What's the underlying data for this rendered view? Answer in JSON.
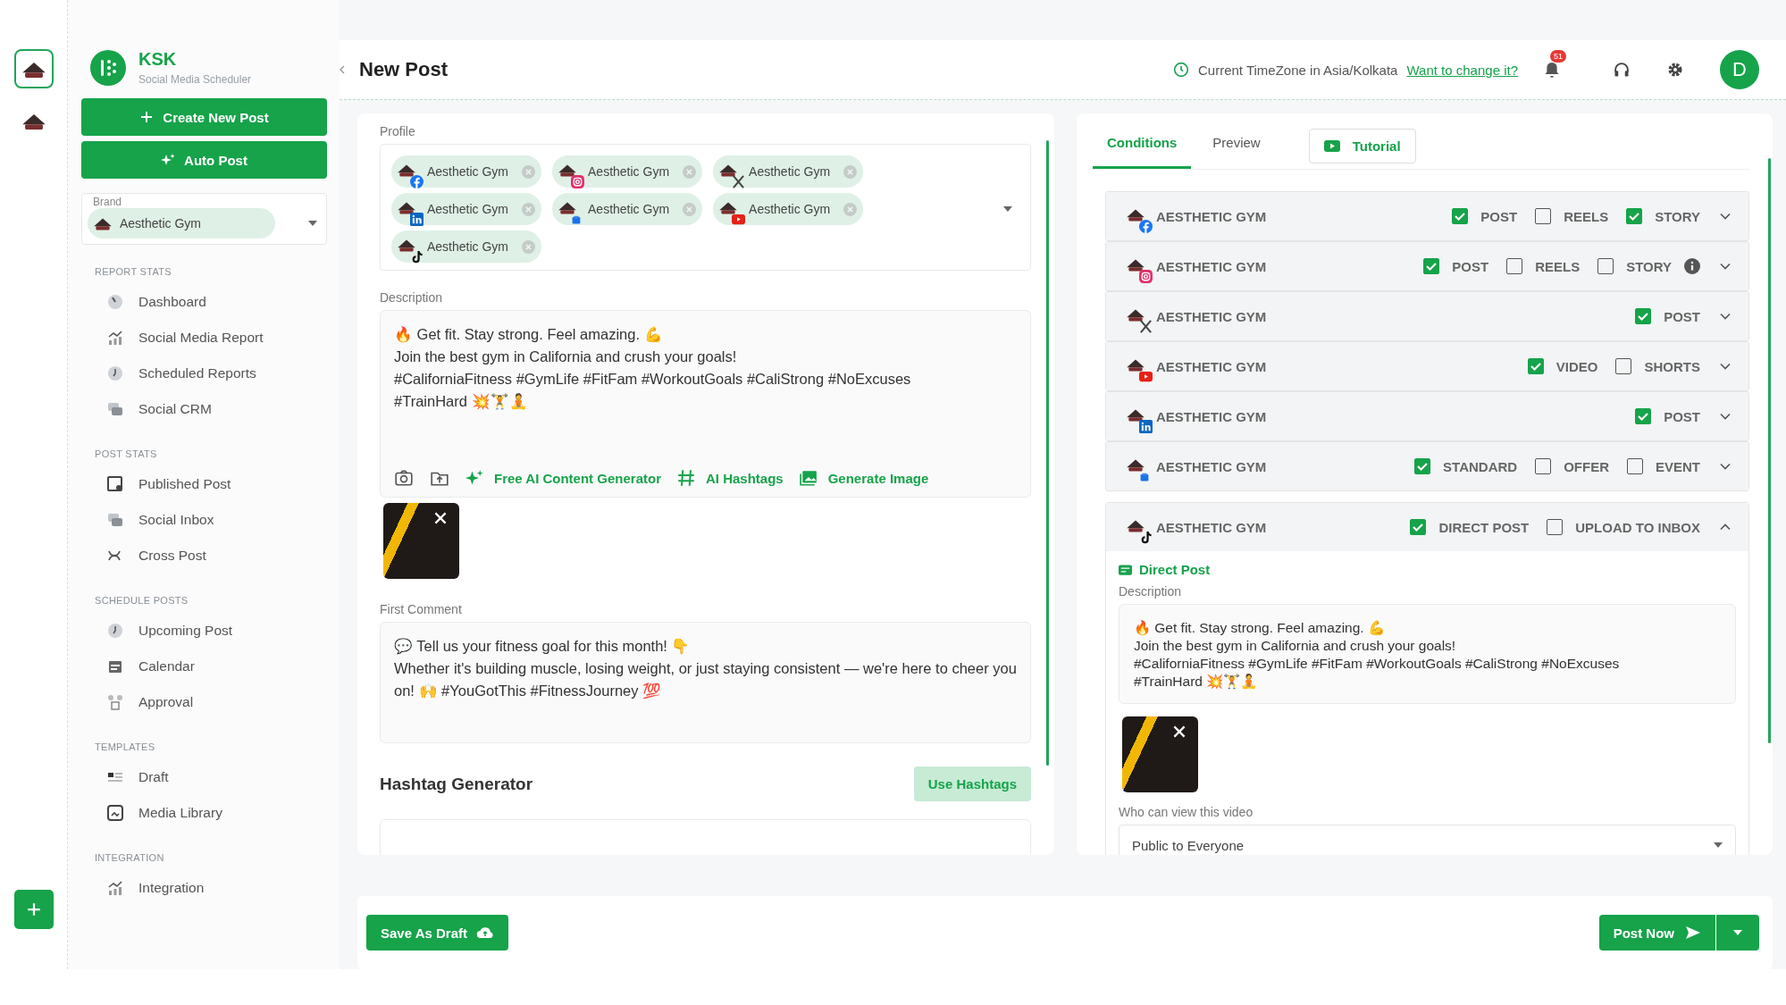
{
  "rail": {
    "accounts": [
      {
        "selected": true
      },
      {
        "selected": false
      }
    ]
  },
  "brand": {
    "name": "KSK",
    "tagline": "Social Media Scheduler"
  },
  "actions": [
    {
      "kind": "create",
      "label": "Create New Post"
    },
    {
      "kind": "auto",
      "label": "Auto Post"
    }
  ],
  "brand_select": {
    "label": "Brand",
    "value": "Aesthetic Gym"
  },
  "nav": [
    {
      "heading": "REPORT STATS",
      "items": [
        {
          "kind": "gauge",
          "label": "Dashboard"
        },
        {
          "kind": "chart",
          "label": "Social Media Report"
        },
        {
          "kind": "clock",
          "label": "Scheduled Reports"
        },
        {
          "kind": "chat",
          "label": "Social CRM"
        }
      ]
    },
    {
      "heading": "POST STATS",
      "items": [
        {
          "kind": "publish",
          "label": "Published Post"
        },
        {
          "kind": "chat",
          "label": "Social Inbox"
        },
        {
          "kind": "cross",
          "label": "Cross Post"
        }
      ]
    },
    {
      "heading": "SCHEDULE POSTS",
      "items": [
        {
          "kind": "clock",
          "label": "Upcoming Post"
        },
        {
          "kind": "calendar",
          "label": "Calendar"
        },
        {
          "kind": "approval",
          "label": "Approval"
        }
      ]
    },
    {
      "heading": "TEMPLATES",
      "items": [
        {
          "kind": "draft",
          "label": "Draft"
        },
        {
          "kind": "media",
          "label": "Media Library"
        }
      ]
    },
    {
      "heading": "INTEGRATION",
      "items": [
        {
          "kind": "chart",
          "label": "Integration"
        }
      ]
    }
  ],
  "header": {
    "title": "New Post",
    "timezone": "Current TimeZone in Asia/Kolkata",
    "change_link": "Want to change it?",
    "notifications": "51",
    "avatar": "D"
  },
  "composer": {
    "profile_label": "Profile",
    "profiles": [
      {
        "kind": "facebook",
        "label": "Aesthetic Gym"
      },
      {
        "kind": "instagram",
        "label": "Aesthetic Gym"
      },
      {
        "kind": "x",
        "label": "Aesthetic Gym"
      },
      {
        "kind": "linkedin",
        "label": "Aesthetic Gym"
      },
      {
        "kind": "google",
        "label": "Aesthetic Gym"
      },
      {
        "kind": "youtube",
        "label": "Aesthetic Gym"
      },
      {
        "kind": "tiktok",
        "label": "Aesthetic Gym"
      }
    ],
    "description_label": "Description",
    "description": "🔥 Get fit. Stay strong. Feel amazing. 💪\nJoin the best gym in California and crush your goals!\n#CaliforniaFitness #GymLife #FitFam #WorkoutGoals #CaliStrong #NoExcuses\n#TrainHard 💥🏋️🧘",
    "tools": [
      {
        "kind": "camera"
      },
      {
        "kind": "upload"
      },
      {
        "kind": "ai",
        "label": "Free AI Content Generator"
      },
      {
        "kind": "hashtag",
        "label": "AI Hashtags"
      },
      {
        "kind": "image",
        "label": "Generate Image"
      }
    ],
    "first_comment_label": "First Comment",
    "first_comment": "💬 Tell us your fitness goal for this month! 👇\nWhether it's building muscle, losing weight, or just staying consistent — we're here to cheer you on! 🙌 #YouGotThis #FitnessJourney 💯",
    "hashtag_title": "Hashtag Generator",
    "hashtag_button": "Use Hashtags"
  },
  "conditions": {
    "tabs": [
      {
        "kind": "tab",
        "label": "Conditions",
        "selected": true
      },
      {
        "kind": "tab",
        "label": "Preview",
        "selected": false
      },
      {
        "kind": "video",
        "label": "Tutorial",
        "selected": false
      }
    ],
    "accounts": [
      {
        "kind": "facebook",
        "name": "AESTHETIC GYM",
        "info": false,
        "expanded": false,
        "options": [
          {
            "label": "POST",
            "checked": true
          },
          {
            "label": "REELS",
            "checked": false
          },
          {
            "label": "STORY",
            "checked": true
          }
        ]
      },
      {
        "kind": "instagram",
        "name": "AESTHETIC GYM",
        "info": true,
        "expanded": false,
        "options": [
          {
            "label": "POST",
            "checked": true
          },
          {
            "label": "REELS",
            "checked": false
          },
          {
            "label": "STORY",
            "checked": false
          }
        ]
      },
      {
        "kind": "x",
        "name": "AESTHETIC GYM",
        "info": false,
        "expanded": false,
        "options": [
          {
            "label": "POST",
            "checked": true
          }
        ]
      },
      {
        "kind": "youtube",
        "name": "AESTHETIC GYM",
        "info": false,
        "expanded": false,
        "options": [
          {
            "label": "VIDEO",
            "checked": true
          },
          {
            "label": "SHORTS",
            "checked": false
          }
        ]
      },
      {
        "kind": "linkedin",
        "name": "AESTHETIC GYM",
        "info": false,
        "expanded": false,
        "options": [
          {
            "label": "POST",
            "checked": true
          }
        ]
      },
      {
        "kind": "google",
        "name": "AESTHETIC GYM",
        "info": false,
        "expanded": false,
        "options": [
          {
            "label": "STANDARD",
            "checked": true
          },
          {
            "label": "OFFER",
            "checked": false
          },
          {
            "label": "EVENT",
            "checked": false
          }
        ]
      },
      {
        "kind": "tiktok",
        "name": "AESTHETIC GYM",
        "info": false,
        "expanded": true,
        "options": [
          {
            "label": "DIRECT POST",
            "checked": true
          },
          {
            "label": "UPLOAD TO INBOX",
            "checked": false
          }
        ],
        "detail": {
          "heading": "Direct Post",
          "description_label": "Description",
          "description": "🔥 Get fit. Stay strong. Feel amazing. 💪\nJoin the best gym in California and crush your goals!\n#CaliforniaFitness #GymLife #FitFam #WorkoutGoals #CaliStrong #NoExcuses\n#TrainHard 💥🏋️🧘",
          "privacy_label": "Who can view this video",
          "privacy_value": "Public to Everyone"
        }
      }
    ]
  },
  "footer": {
    "save_draft": "Save As Draft",
    "post_now": "Post Now"
  }
}
